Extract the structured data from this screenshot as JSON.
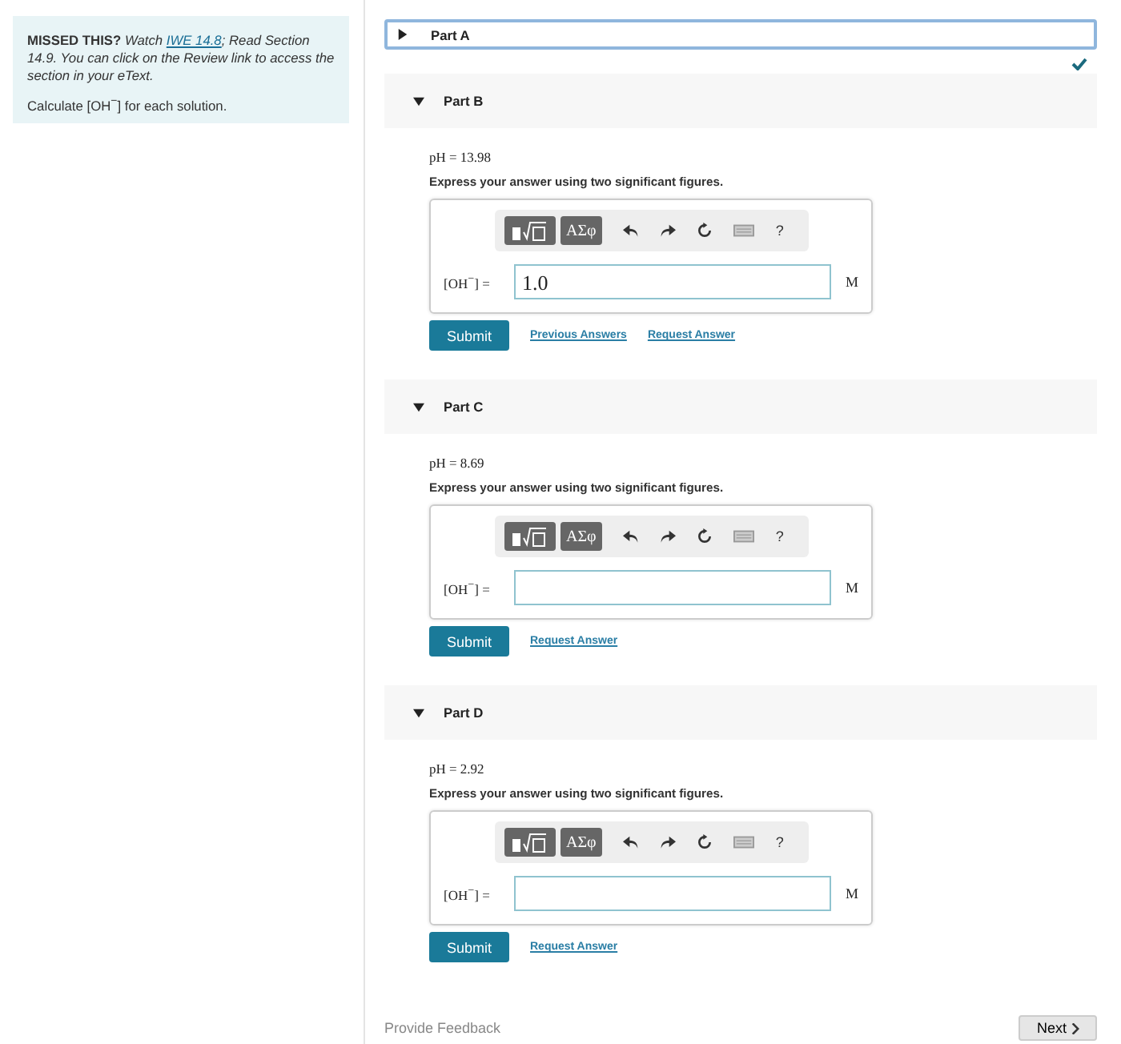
{
  "note": {
    "lead": "MISSED THIS?",
    "before_link": "Watch",
    "link": "IWE 14.8",
    "after_link": "; Read Section 14.9. You can click on the Review link to access the section in your eText."
  },
  "instruction": "Calculate [OH$^{−}$] for each solution.",
  "parts": [
    {
      "title": "Part A",
      "expanded": false,
      "focused": true,
      "complete": true
    },
    {
      "title": "Part B",
      "expanded": true,
      "focused": false,
      "complete": false,
      "given": "pH = 13.98",
      "prompt": "Express your answer using two significant figures.",
      "symbols": "ΑΣφ",
      "help": "?",
      "variable": "[OH$^{−}$] =",
      "value": "1.0",
      "unit": "M",
      "submit": "Submit",
      "links": [
        "Previous Answers",
        "Request Answer"
      ]
    },
    {
      "title": "Part C",
      "expanded": true,
      "focused": false,
      "complete": false,
      "given": "pH = 8.69",
      "prompt": "Express your answer using two significant figures.",
      "symbols": "ΑΣφ",
      "help": "?",
      "variable": "[OH$^{−}$] =",
      "unit": "M",
      "submit": "Submit",
      "links": [
        "Request Answer"
      ]
    },
    {
      "title": "Part D",
      "expanded": true,
      "focused": false,
      "complete": false,
      "given": "pH = 2.92",
      "prompt": "Express your answer using two significant figures.",
      "symbols": "ΑΣφ",
      "help": "?",
      "variable": "[OH$^{−}$] =",
      "unit": "M",
      "submit": "Submit",
      "links": [
        "Request Answer"
      ]
    }
  ],
  "footer": {
    "feedback": "Provide Feedback",
    "next": "Next"
  }
}
